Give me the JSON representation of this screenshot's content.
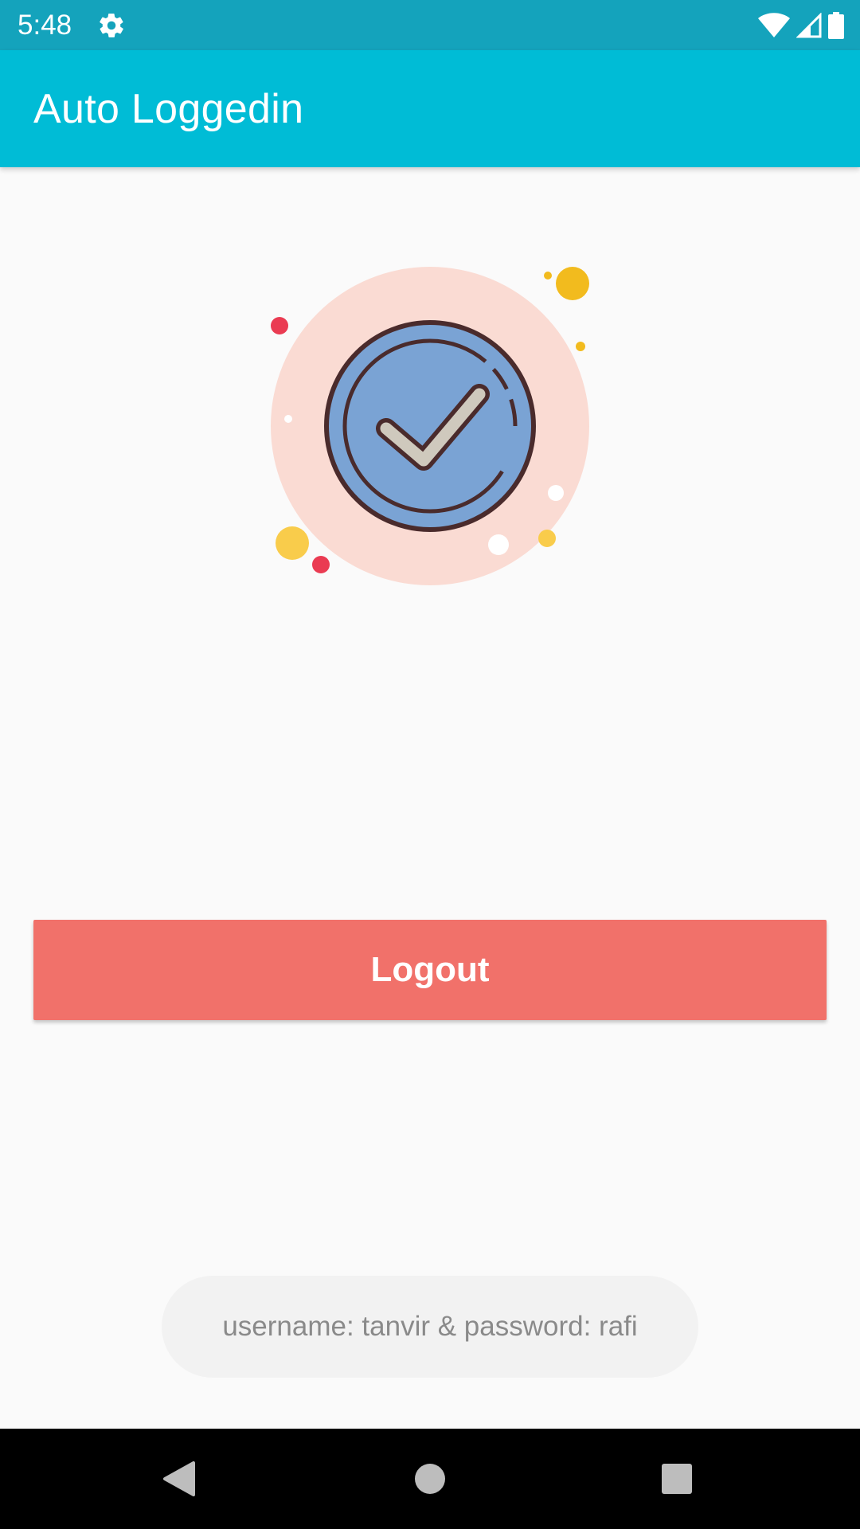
{
  "status_bar": {
    "time": "5:48",
    "icons": [
      "settings-gear-icon",
      "wifi-icon",
      "cell-signal-icon",
      "battery-icon"
    ],
    "color": "#14a3bc"
  },
  "app_bar": {
    "title": "Auto Loggedin",
    "color": "#00bcd6"
  },
  "illustration": {
    "icon": "check-badge-icon"
  },
  "logout_button": {
    "label": "Logout",
    "color": "#f1716a"
  },
  "toast": {
    "message": "username: tanvir & password: rafi"
  },
  "nav_bar": {
    "icons": [
      "back-icon",
      "home-icon",
      "recents-icon"
    ]
  }
}
